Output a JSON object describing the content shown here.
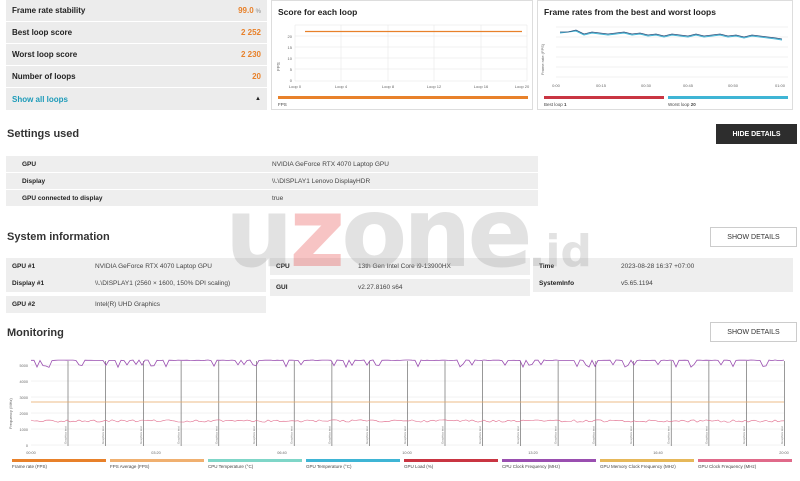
{
  "stats": {
    "frame_rate_stability": {
      "label": "Frame rate stability",
      "value": "99.0",
      "unit": "%"
    },
    "best_loop_score": {
      "label": "Best loop score",
      "value": "2 252"
    },
    "worst_loop_score": {
      "label": "Worst loop score",
      "value": "2 230"
    },
    "number_of_loops": {
      "label": "Number of loops",
      "value": "20"
    },
    "show_all": "Show all loops"
  },
  "score_card": {
    "title": "Score for each loop",
    "ylabel": "FPS",
    "x_ticks": [
      "Loop 0",
      "Loop 4",
      "Loop 8",
      "Loop 12",
      "Loop 16",
      "Loop 20"
    ],
    "y_ticks": [
      "20",
      "15",
      "10",
      "5",
      "0"
    ],
    "legend": "FPS",
    "color": "#e8812a"
  },
  "frame_card": {
    "title": "Frame rates from the best and worst loops",
    "ylabel": "Frame rate (FPS)",
    "x_ticks": [
      "0:00",
      "00:15",
      "00:30",
      "00:45",
      "00:50",
      "01:00"
    ],
    "best_label": "Best loop",
    "best_value": "1",
    "worst_label": "Worst loop",
    "worst_value": "20",
    "best_color": "#c93542",
    "worst_color": "#3fb5d5"
  },
  "settings": {
    "title": "Settings used",
    "hide_details": "HIDE DETAILS",
    "rows": [
      {
        "key": "GPU",
        "value": "NVIDIA GeForce RTX 4070 Laptop GPU"
      },
      {
        "key": "Display",
        "value": "\\\\.\\DISPLAY1 Lenovo DisplayHDR"
      },
      {
        "key": "GPU connected to display",
        "value": "true"
      }
    ]
  },
  "system": {
    "title": "System information",
    "show_details": "SHOW DETAILS",
    "gpu1_key": "GPU #1",
    "gpu1_val": "NVIDIA GeForce RTX 4070 Laptop GPU",
    "display1_key": "Display #1",
    "display1_val": "\\\\.\\DISPLAY1 (2560 × 1600, 150% DPI scaling)",
    "gpu2_key": "GPU #2",
    "gpu2_val": "Intel(R) UHD Graphics",
    "cpu_key": "CPU",
    "cpu_val": "13th Gen Intel Core i9-13900HX",
    "gui_key": "GUI",
    "gui_val": "v2.27.8160 s64",
    "time_key": "Time",
    "time_val": "2023-08-28 16:37 +07:00",
    "sysinfo_key": "SystemInfo",
    "sysinfo_val": "v5.65.1194"
  },
  "monitoring": {
    "title": "Monitoring",
    "show_details": "SHOW DETAILS",
    "ylabel": "Frequency (MHz)",
    "y_ticks": [
      "5000",
      "4000",
      "3000",
      "2000",
      "1000",
      "0"
    ],
    "x_ticks": [
      "00:00",
      "03:20",
      "06:40",
      "10:00",
      "13:20",
      "16:40",
      "20:00"
    ],
    "loop_label": "Graphics test",
    "legend": [
      {
        "name": "Frame rate (FPS)",
        "color": "#e8812a"
      },
      {
        "name": "FPS Average (FPS)",
        "color": "#f0b070"
      },
      {
        "name": "CPU Temperature (°C)",
        "color": "#7fd6c8"
      },
      {
        "name": "GPU Temperature (°C)",
        "color": "#3fb5d5"
      },
      {
        "name": "GPU Load (%)",
        "color": "#c93542"
      },
      {
        "name": "CPU Clock Frequency (MHz)",
        "color": "#9a4fb0"
      },
      {
        "name": "GPU Memory Clock Frequency (MHz)",
        "color": "#e6b85a"
      },
      {
        "name": "GPU Clock Frequency (MHz)",
        "color": "#e06a8a"
      }
    ]
  },
  "watermark": {
    "main_a": "u",
    "main_z": "z",
    "main_b": "one",
    "suffix": ".id"
  }
}
